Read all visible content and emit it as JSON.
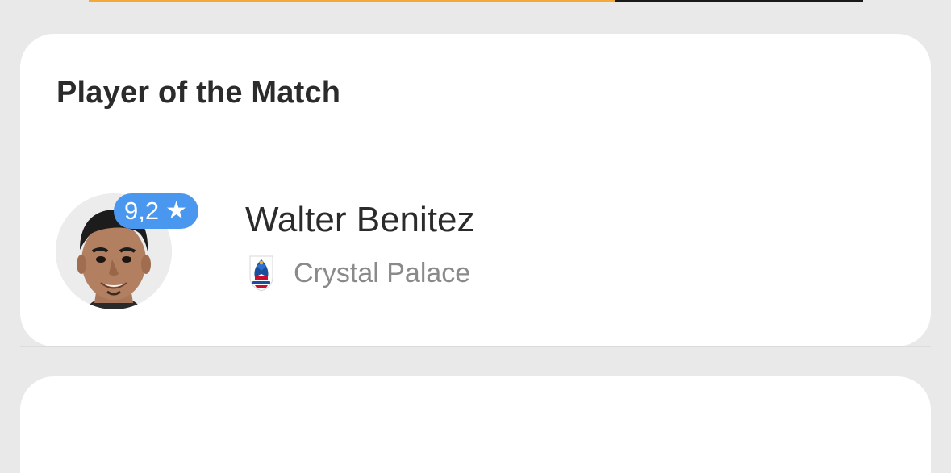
{
  "progress": {
    "fraction": 0.68,
    "fill_color": "#f3a935",
    "track_color": "#1a1a1a"
  },
  "card": {
    "title": "Player of the Match",
    "player": {
      "name": "Walter Benitez",
      "rating": "9,2",
      "rating_icon": "star-icon",
      "avatar_icon": "player-photo",
      "team": {
        "name": "Crystal Palace",
        "crest_icon": "crystal-palace-crest"
      }
    }
  },
  "colors": {
    "badge": "#4a97ef",
    "background": "#e9e9e9",
    "card": "#ffffff"
  }
}
